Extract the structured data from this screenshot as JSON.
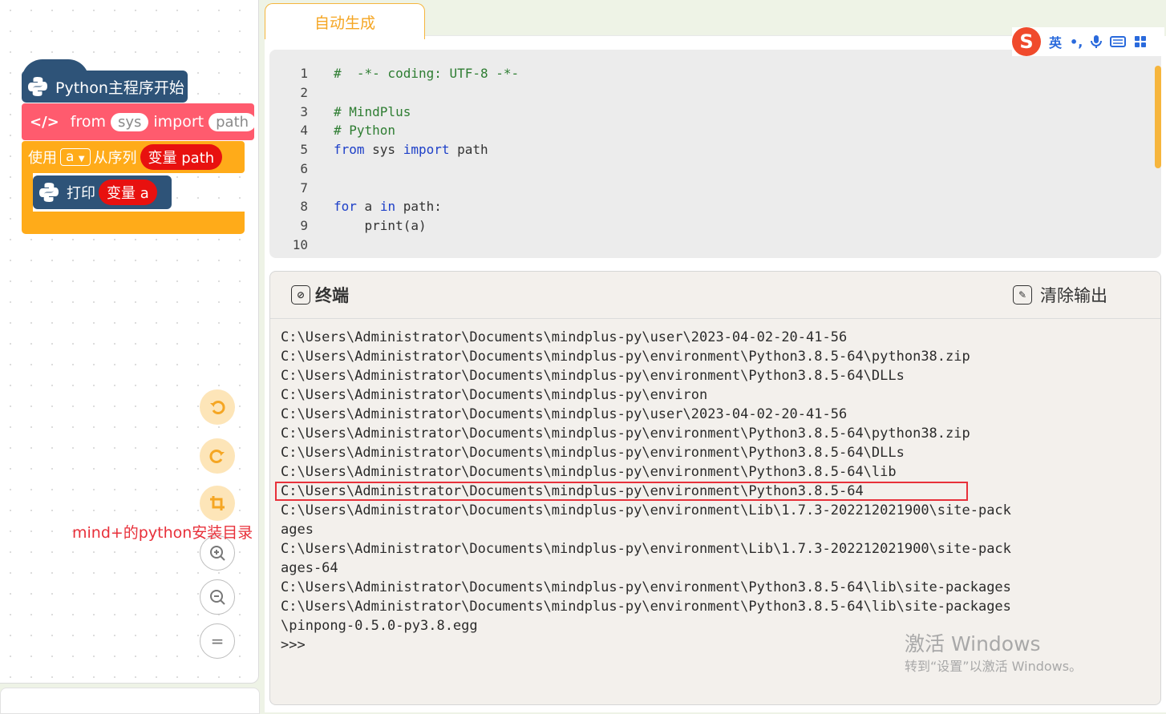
{
  "blocks": {
    "main": "Python主程序开始",
    "import": {
      "from": "from",
      "module": "sys",
      "import": "import",
      "name": "path"
    },
    "for": {
      "use": "使用",
      "var": "a",
      "from_seq": "从序列",
      "var_label": "变量 path"
    },
    "print": {
      "label": "打印",
      "var_label": "变量 a"
    }
  },
  "annotation": "mind+的python安装目录",
  "tab": {
    "label": "自动生成"
  },
  "editor": {
    "lines": [
      {
        "n": "1",
        "text": "#  -*- coding: UTF-8 -*-"
      },
      {
        "n": "2",
        "text": ""
      },
      {
        "n": "3",
        "text": "# MindPlus"
      },
      {
        "n": "4",
        "text": "# Python"
      },
      {
        "n": "5",
        "kw1": "from",
        "mid": " sys ",
        "kw2": "import",
        "rest": " path"
      },
      {
        "n": "6",
        "text": ""
      },
      {
        "n": "7",
        "text": ""
      },
      {
        "n": "8",
        "kw1": "for",
        "mid": " a ",
        "kw2": "in",
        "rest": " path:"
      },
      {
        "n": "9",
        "text": "    print(a)"
      },
      {
        "n": "10",
        "text": ""
      }
    ]
  },
  "ime": {
    "mode": "英",
    "punct": "•,",
    "logo": "S"
  },
  "terminal": {
    "title": "终端",
    "clear_label": "清除输出",
    "lines": [
      "C:\\Users\\Administrator\\Documents\\mindplus-py\\user\\2023-04-02-20-41-56",
      "C:\\Users\\Administrator\\Documents\\mindplus-py\\environment\\Python3.8.5-64\\python38.zip",
      "C:\\Users\\Administrator\\Documents\\mindplus-py\\environment\\Python3.8.5-64\\DLLs",
      "C:\\Users\\Administrator\\Documents\\mindplus-py\\environ",
      "C:\\Users\\Administrator\\Documents\\mindplus-py\\user\\2023-04-02-20-41-56",
      "C:\\Users\\Administrator\\Documents\\mindplus-py\\environment\\Python3.8.5-64\\python38.zip",
      "C:\\Users\\Administrator\\Documents\\mindplus-py\\environment\\Python3.8.5-64\\DLLs",
      "C:\\Users\\Administrator\\Documents\\mindplus-py\\environment\\Python3.8.5-64\\lib",
      "C:\\Users\\Administrator\\Documents\\mindplus-py\\environment\\Python3.8.5-64",
      "C:\\Users\\Administrator\\Documents\\mindplus-py\\environment\\Lib\\1.7.3-202212021900\\site-pack",
      "ages",
      "C:\\Users\\Administrator\\Documents\\mindplus-py\\environment\\Lib\\1.7.3-202212021900\\site-pack",
      "ages-64",
      "C:\\Users\\Administrator\\Documents\\mindplus-py\\environment\\Python3.8.5-64\\lib\\site-packages",
      "C:\\Users\\Administrator\\Documents\\mindplus-py\\environment\\Python3.8.5-64\\lib\\site-packages",
      "\\pinpong-0.5.0-py3.8.egg",
      ">>>"
    ]
  },
  "watermark": {
    "line1": "激活 Windows",
    "line2": "转到“设置”以激活 Windows。"
  },
  "colors": {
    "accent": "#f5a623",
    "python_block": "#2e5378",
    "import_block": "#ff5b6e",
    "loop_block": "#ffab19",
    "variable": "#e8110f",
    "highlight": "#e8303a"
  }
}
